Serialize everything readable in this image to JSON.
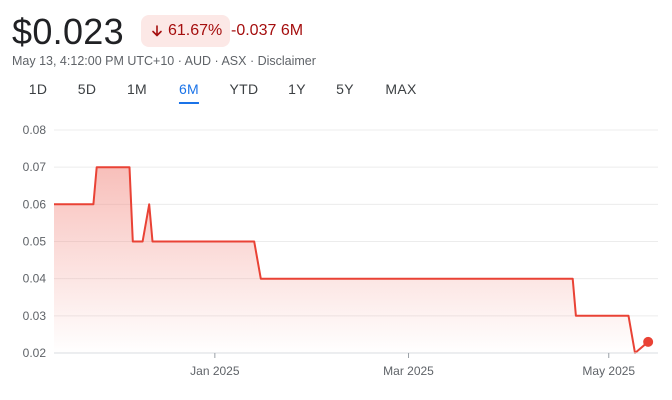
{
  "header": {
    "price": "$0.023",
    "change_percent": "61.67%",
    "change_direction": "down",
    "change_abs": "-0.037 6M",
    "meta": "May 13, 4:12:00 PM UTC+10 · AUD · ASX · Disclaimer"
  },
  "tabs": [
    {
      "label": "1D",
      "active": false
    },
    {
      "label": "5D",
      "active": false
    },
    {
      "label": "1M",
      "active": false
    },
    {
      "label": "6M",
      "active": true
    },
    {
      "label": "YTD",
      "active": false
    },
    {
      "label": "1Y",
      "active": false
    },
    {
      "label": "5Y",
      "active": false
    },
    {
      "label": "MAX",
      "active": false
    }
  ],
  "colors": {
    "line": "#e94235",
    "fill": "#f28b82",
    "negative_text": "#a50e0e",
    "negative_bg": "#fce8e6",
    "active_tab": "#1a73e8",
    "grid": "#ececec"
  },
  "chart_data": {
    "type": "area",
    "x": [
      "2024-11-13",
      "2024-11-25",
      "2024-11-26",
      "2024-12-06",
      "2024-12-07",
      "2024-12-09",
      "2024-12-10",
      "2024-12-12",
      "2024-12-13",
      "2024-12-15",
      "2025-01-13",
      "2025-01-15",
      "2025-04-20",
      "2025-04-21",
      "2025-05-07",
      "2025-05-09",
      "2025-05-13"
    ],
    "values": [
      0.06,
      0.06,
      0.07,
      0.07,
      0.05,
      0.05,
      0.05,
      0.06,
      0.05,
      0.05,
      0.05,
      0.04,
      0.04,
      0.03,
      0.03,
      0.02,
      0.023
    ],
    "ylim": [
      0.02,
      0.08
    ],
    "yticks": [
      "0.08",
      "0.07",
      "0.06",
      "0.05",
      "0.04",
      "0.03",
      "0.02"
    ],
    "xticks": [
      {
        "date": "2025-01-01",
        "label": "Jan 2025"
      },
      {
        "date": "2025-03-01",
        "label": "Mar 2025"
      },
      {
        "date": "2025-05-01",
        "label": "May 2025"
      }
    ],
    "grid": true,
    "xlim": [
      "2024-11-13",
      "2025-05-16"
    ]
  }
}
